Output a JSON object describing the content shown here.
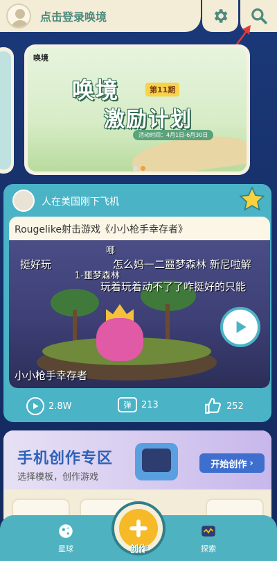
{
  "header": {
    "login_text": "点击登录唤境",
    "settings_icon": "gear-icon",
    "search_icon": "search-icon"
  },
  "banner": {
    "logo_text": "唤境",
    "title_line1": "唤境",
    "title_line2": "激励计划",
    "tag": "第11期",
    "date_text": "活动时间：4月1日-6月30日",
    "dots": 2,
    "active_dot": 1
  },
  "feed_card": {
    "username": "人在美国刚下飞机",
    "game_title": "Rougelike射击游戏《小小枪手幸存者》",
    "video_title": "小小枪手幸存者",
    "danmaku": [
      "哪",
      "挺好玩",
      "怎么妈一二噩梦森林 新尼啦解",
      "玩着玩着动不了了咋挺好的只能",
      "1-噩梦森林"
    ],
    "stats": {
      "plays": "2.8W",
      "danmaku_label": "弹",
      "danmaku_count": "213",
      "likes": "252"
    }
  },
  "create_zone": {
    "title": "手机创作专区",
    "subtitle": "选择模板，创作游戏",
    "button_label": "开始创作"
  },
  "bottom_nav": {
    "items": [
      {
        "label": "星球",
        "icon": "planet-icon"
      },
      {
        "label": "创作",
        "icon": "plus-icon"
      },
      {
        "label": "探索",
        "icon": "tv-icon"
      }
    ]
  },
  "colors": {
    "background": "#1b3a7a",
    "cream": "#f3ecd6",
    "teal": "#4ab3c6",
    "accent_green": "#4c8a7e",
    "create_blue": "#3f6fce",
    "fab_yellow": "#f6b928"
  }
}
